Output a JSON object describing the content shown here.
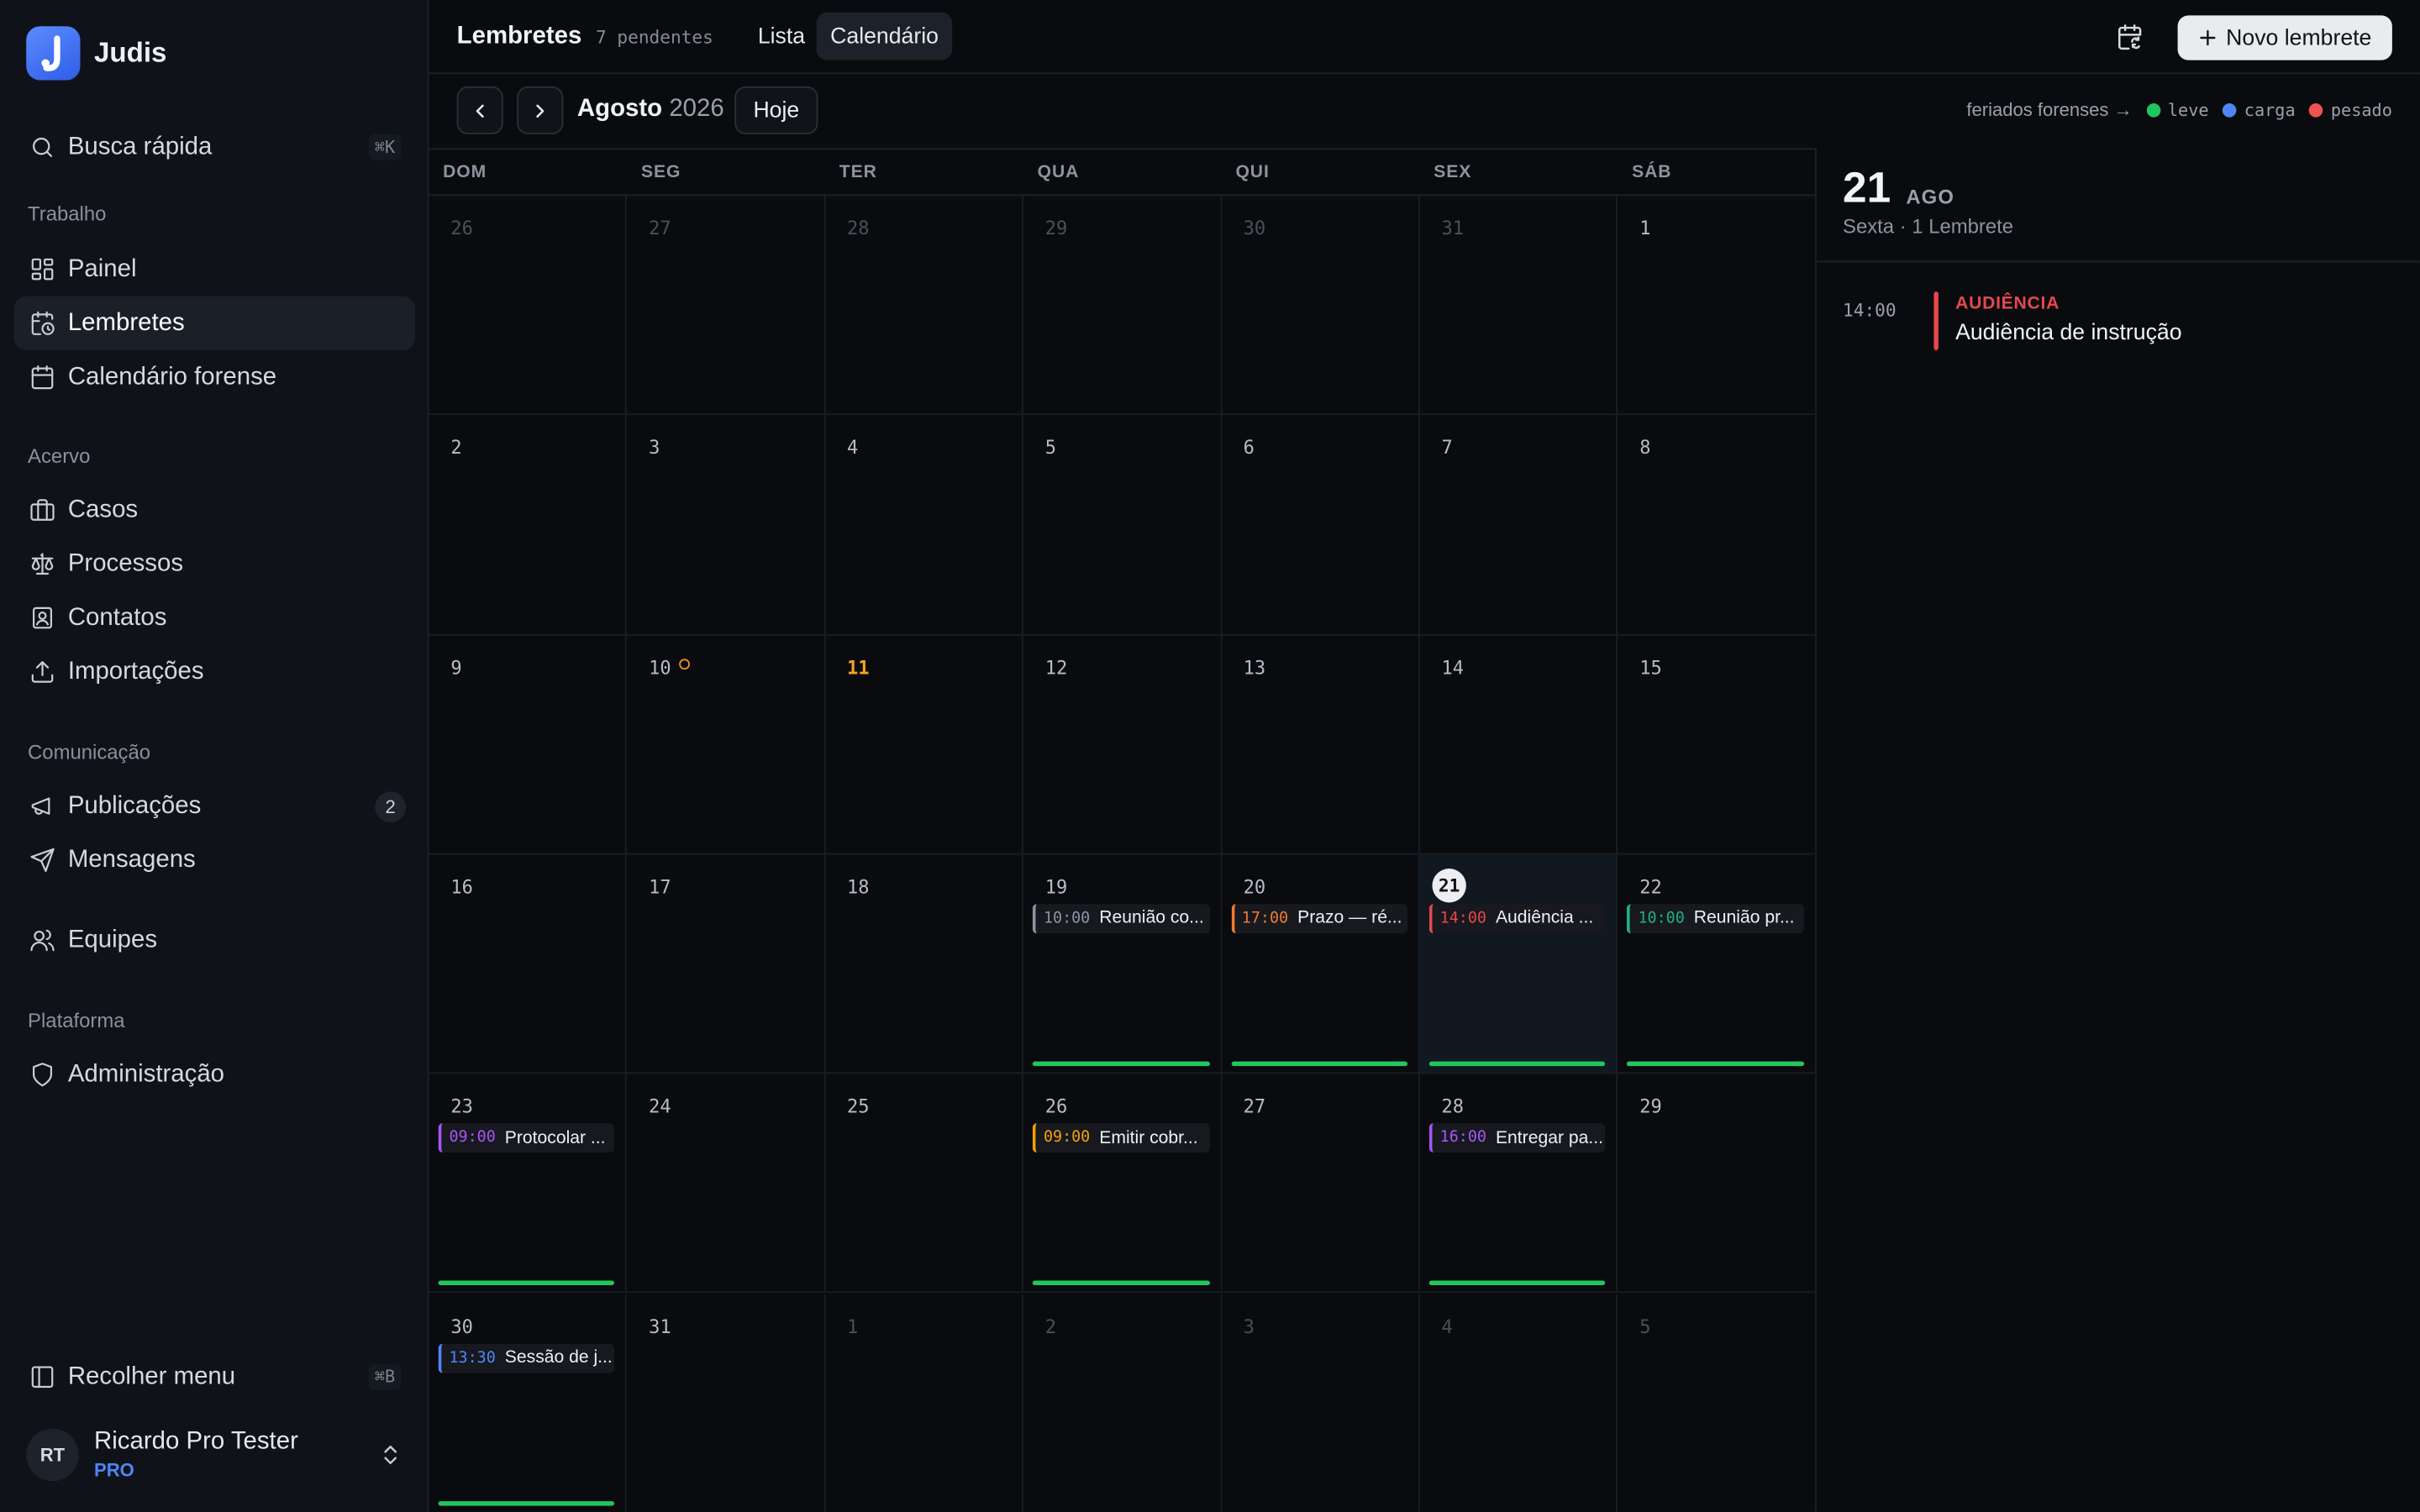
{
  "app": {
    "name": "Judis"
  },
  "sidebar": {
    "search": {
      "label": "Busca rápida",
      "shortcut": "⌘K"
    },
    "sections": {
      "trabalho": "Trabalho",
      "acervo": "Acervo",
      "comunicacao": "Comunicação",
      "plataforma": "Plataforma"
    },
    "items": {
      "painel": "Painel",
      "lembretes": "Lembretes",
      "calendario": "Calendário forense",
      "casos": "Casos",
      "processos": "Processos",
      "contatos": "Contatos",
      "importacoes": "Importações",
      "publicacoes": "Publicações",
      "publicacoes_count": "2",
      "mensagens": "Mensagens",
      "equipes": "Equipes",
      "administracao": "Administração"
    },
    "collapse": {
      "label": "Recolher menu",
      "shortcut": "⌘B"
    },
    "user": {
      "initials": "RT",
      "name": "Ricardo Pro Tester",
      "plan": "PRO"
    }
  },
  "header": {
    "title": "Lembretes",
    "pending": "7 pendentes",
    "tabs": {
      "lista": "Lista",
      "calendario": "Calendário"
    },
    "new_button": "Novo lembrete"
  },
  "calendar": {
    "month": "Agosto",
    "year": "2026",
    "today_button": "Hoje",
    "legend": {
      "label": "feriados forenses →",
      "leve": "leve",
      "carga": "carga",
      "pesado": "pesado"
    },
    "colors": {
      "leve": "#22c55e",
      "carga": "#4f86f7",
      "pesado": "#ef5350",
      "today": "#f5a524",
      "holiday": "#e3902c"
    },
    "weekdays": [
      "DOM",
      "SEG",
      "TER",
      "QUA",
      "QUI",
      "SEX",
      "SÁB"
    ],
    "weeks": [
      [
        {
          "d": "26",
          "out": true
        },
        {
          "d": "27",
          "out": true
        },
        {
          "d": "28",
          "out": true
        },
        {
          "d": "29",
          "out": true
        },
        {
          "d": "30",
          "out": true
        },
        {
          "d": "31",
          "out": true
        },
        {
          "d": "1"
        }
      ],
      [
        {
          "d": "2"
        },
        {
          "d": "3"
        },
        {
          "d": "4"
        },
        {
          "d": "5"
        },
        {
          "d": "6"
        },
        {
          "d": "7"
        },
        {
          "d": "8"
        }
      ],
      [
        {
          "d": "9"
        },
        {
          "d": "10",
          "holiday": true
        },
        {
          "d": "11",
          "today": true
        },
        {
          "d": "12"
        },
        {
          "d": "13"
        },
        {
          "d": "14"
        },
        {
          "d": "15"
        }
      ],
      [
        {
          "d": "16"
        },
        {
          "d": "17"
        },
        {
          "d": "18"
        },
        {
          "d": "19",
          "load": true,
          "event": {
            "time": "10:00",
            "label": "Reunião co...",
            "color": "#8b95a5"
          }
        },
        {
          "d": "20",
          "load": true,
          "event": {
            "time": "17:00",
            "label": "Prazo — ré...",
            "color": "#f07b2e"
          }
        },
        {
          "d": "21",
          "selected": true,
          "load": true,
          "event": {
            "time": "14:00",
            "label": "Audiência ...",
            "color": "#e5484d"
          }
        },
        {
          "d": "22",
          "load": true,
          "event": {
            "time": "10:00",
            "label": "Reunião pr...",
            "color": "#22b07d"
          }
        }
      ],
      [
        {
          "d": "23",
          "load": true,
          "event": {
            "time": "09:00",
            "label": "Protocolar ...",
            "color": "#a855f7"
          }
        },
        {
          "d": "24"
        },
        {
          "d": "25"
        },
        {
          "d": "26",
          "load": true,
          "event": {
            "time": "09:00",
            "label": "Emitir cobr...",
            "color": "#f59e0b"
          }
        },
        {
          "d": "27"
        },
        {
          "d": "28",
          "load": true,
          "event": {
            "time": "16:00",
            "label": "Entregar pa...",
            "color": "#a855f7"
          }
        },
        {
          "d": "29"
        }
      ],
      [
        {
          "d": "30",
          "load": true,
          "event": {
            "time": "13:30",
            "label": "Sessão de j...",
            "color": "#4f86f7"
          }
        },
        {
          "d": "31"
        },
        {
          "d": "1",
          "out": true
        },
        {
          "d": "2",
          "out": true
        },
        {
          "d": "3",
          "out": true
        },
        {
          "d": "4",
          "out": true
        },
        {
          "d": "5",
          "out": true
        }
      ]
    ]
  },
  "detail": {
    "day": "21",
    "month": "AGO",
    "subtitle": "Sexta · 1 Lembrete",
    "event": {
      "time": "14:00",
      "category": "AUDIÊNCIA",
      "title": "Audiência de instrução"
    }
  }
}
